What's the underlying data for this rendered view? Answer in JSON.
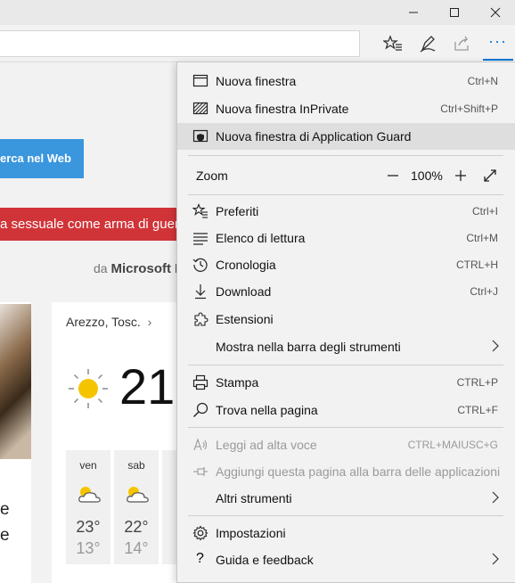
{
  "window": {
    "minimize_icon": "minimize-icon",
    "maximize_icon": "maximize-icon",
    "close_icon": "close-icon"
  },
  "toolbar": {
    "icons": [
      "favorites-star-icon",
      "pen-annotate-icon",
      "share-icon",
      "more-icon"
    ],
    "more_label": "···",
    "accent": "#0078d7"
  },
  "page": {
    "search_button": "erca nel Web",
    "news_banner": "a sessuale come arma di guer",
    "byline_prefix": "da",
    "byline_source": "Microsoft N",
    "photo_text_line1": "e",
    "photo_text_line2": "e",
    "weather": {
      "location": "Arezzo, Tosc.",
      "location_chevron": "›",
      "temp": "21°",
      "days": [
        {
          "name": "ven",
          "hi": "23°",
          "lo": "13°"
        },
        {
          "name": "sab",
          "hi": "22°",
          "lo": "14°"
        }
      ]
    }
  },
  "menu": {
    "items": [
      {
        "label": "Nuova finestra",
        "shortcut": "Ctrl+N",
        "icon": "new-window-icon"
      },
      {
        "label": "Nuova finestra InPrivate",
        "shortcut": "Ctrl+Shift+P",
        "icon": "inprivate-window-icon"
      },
      {
        "label": "Nuova finestra di Application Guard",
        "shortcut": "",
        "icon": "application-guard-icon"
      }
    ],
    "zoom": {
      "label": "Zoom",
      "value": "100%",
      "minus": "—",
      "plus": "+"
    },
    "items2": [
      {
        "label": "Preferiti",
        "shortcut": "Ctrl+I",
        "icon": "favorites-icon"
      },
      {
        "label": "Elenco di lettura",
        "shortcut": "Ctrl+M",
        "icon": "reading-list-icon"
      },
      {
        "label": "Cronologia",
        "shortcut": "CTRL+H",
        "icon": "history-icon"
      },
      {
        "label": "Download",
        "shortcut": "Ctrl+J",
        "icon": "download-icon"
      },
      {
        "label": "Estensioni",
        "shortcut": "",
        "icon": "extensions-icon"
      },
      {
        "label": "Mostra nella barra degli strumenti",
        "shortcut": "",
        "icon": ""
      }
    ],
    "items3": [
      {
        "label": "Stampa",
        "shortcut": "CTRL+P",
        "icon": "print-icon"
      },
      {
        "label": "Trova nella pagina",
        "shortcut": "CTRL+F",
        "icon": "find-icon"
      }
    ],
    "items4": [
      {
        "label": "Leggi ad alta voce",
        "shortcut": "CTRL+MAIUSC+G",
        "icon": "read-aloud-icon"
      },
      {
        "label": "Aggiungi questa pagina alla barra delle applicazioni",
        "shortcut": "",
        "icon": "pin-icon"
      },
      {
        "label": "Altri strumenti",
        "shortcut": "",
        "icon": ""
      }
    ],
    "items5": [
      {
        "label": "Impostazioni",
        "shortcut": "",
        "icon": "settings-icon"
      },
      {
        "label": "Guida e feedback",
        "shortcut": "",
        "icon": "help-icon"
      }
    ]
  }
}
